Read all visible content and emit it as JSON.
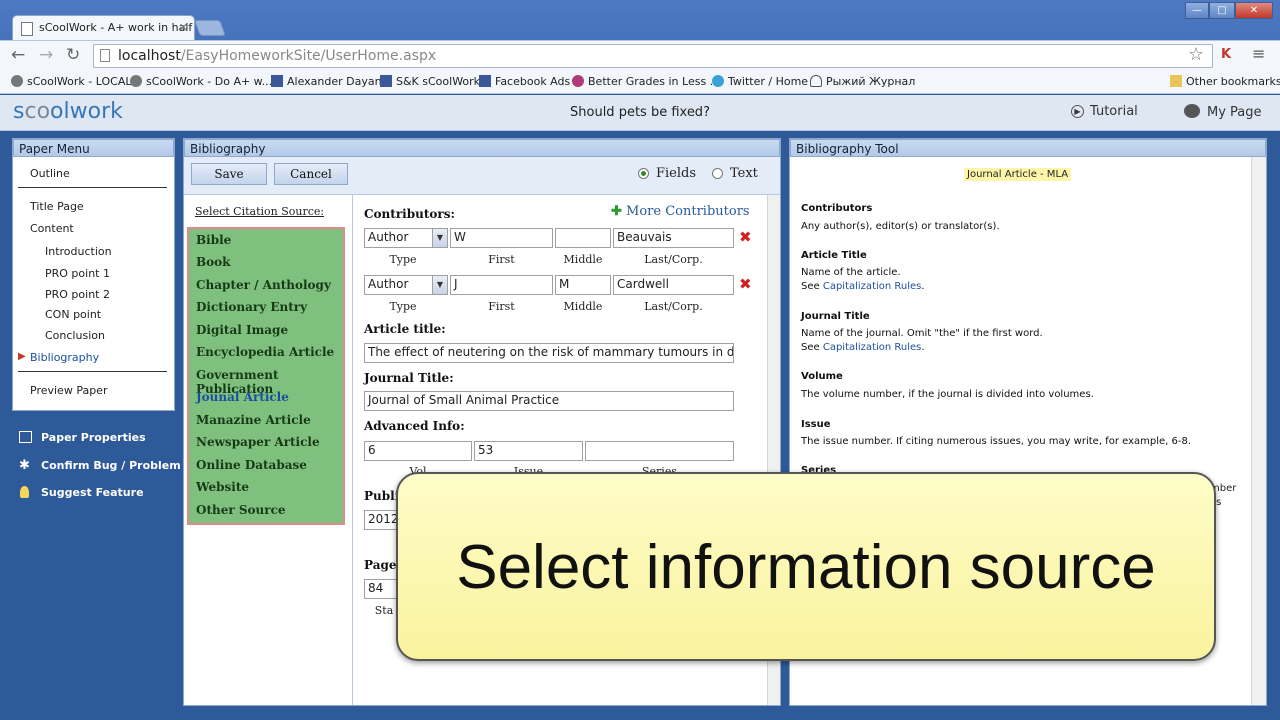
{
  "browser": {
    "tab_title": "sCoolWork - A+ work in half t",
    "url_host": "localhost",
    "url_path": "/EasyHomeworkSite/UserHome.aspx",
    "window_buttons": [
      "—",
      "□",
      "✕"
    ],
    "bookmarks": [
      "sCoolWork - LOCAL",
      "sCoolWork - Do A+ w...",
      "Alexander Dayan",
      "S&K sCoolWork",
      "Facebook Ads",
      "Better Grades in Less ...",
      "Twitter / Home",
      "Рыжий Журнал"
    ],
    "other_bookmarks": "Other bookmarks"
  },
  "app": {
    "logo_a": "s",
    "logo_b": "c",
    "logo_c": "o",
    "logo_d": "olwork",
    "topic": "Should pets be fixed?",
    "tutorial": "Tutorial",
    "my_page": "My Page"
  },
  "paper_menu": {
    "title": "Paper Menu",
    "items": [
      "Outline",
      "Title Page",
      "Content",
      "Introduction",
      "PRO point 1",
      "PRO point 2",
      "CON point",
      "Conclusion",
      "Bibliography",
      "Preview Paper"
    ]
  },
  "side_actions": [
    "Paper Properties",
    "Confirm Bug / Problem",
    "Suggest Feature"
  ],
  "bibliography": {
    "title": "Bibliography",
    "save": "Save",
    "cancel": "Cancel",
    "mode_fields": "Fields",
    "mode_text": "Text",
    "select_source": "Select Citation Source:",
    "sources": [
      "Bible",
      "Book",
      "Chapter / Anthology",
      "Dictionary Entry",
      "Digital Image",
      "Encyclopedia Article",
      "Government Publication",
      "Jounal Article",
      "Manazine Article",
      "Newspaper Article",
      "Online Database",
      "Website",
      "Other Source"
    ],
    "contributors_label": "Contributors:",
    "more_contributors": "More Contributors",
    "contributors": [
      {
        "type": "Author",
        "first": "W",
        "middle": "",
        "last": "Beauvais"
      },
      {
        "type": "Author",
        "first": "J",
        "middle": "M",
        "last": "Cardwell"
      }
    ],
    "col_type": "Type",
    "col_first": "First",
    "col_middle": "Middle",
    "col_last": "Last/Corp.",
    "article_title_label": "Article title:",
    "article_title": "The effect of neutering on the risk of mammary tumours in dogs – a",
    "journal_title_label": "Journal Title:",
    "journal_title": "Journal of Small Animal Practice",
    "advanced_label": "Advanced Info:",
    "volume": "6",
    "issue": "53",
    "series": "",
    "sub_vol": "Vol",
    "sub_issue": "Issue",
    "sub_series": "Series",
    "published_label": "Publi",
    "year": "2012",
    "pages_label": "Pages",
    "pages_start": "84",
    "pages_sub": "Sta"
  },
  "tool": {
    "title": "Bibliography Tool",
    "badge": "Journal Article - MLA",
    "contributors_h": "Contributors",
    "contributors_t": "Any author(s), editor(s) or translator(s).",
    "article_h": "Article Title",
    "article_t": "Name of the article.",
    "see": "See",
    "cap_rules": "Capitalization Rules",
    "journal_h": "Journal Title",
    "journal_t": "Name of the journal. Omit \"the\" if the first word.",
    "volume_h": "Volume",
    "volume_t": "The volume number, if the journal is divided into volumes.",
    "issue_h": "Issue",
    "issue_t": "The issue number. If citing numerous issues, you may write, for example, 6-8.",
    "series_h": "Series",
    "frag1": "mber",
    "frag2": "os"
  },
  "overlay": {
    "caption": "Select information source"
  }
}
